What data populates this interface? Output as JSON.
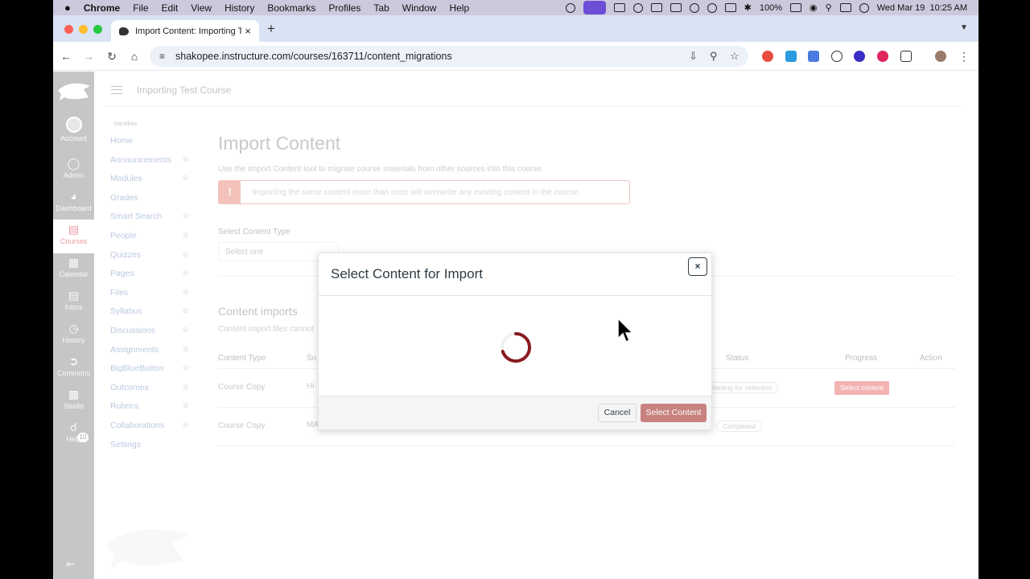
{
  "menubar": {
    "app": "Chrome",
    "items": [
      "File",
      "Edit",
      "View",
      "History",
      "Bookmarks",
      "Profiles",
      "Tab",
      "Window",
      "Help"
    ],
    "battery": "100%",
    "datetime": "Wed Mar 19  10:25 AM"
  },
  "browser": {
    "tab_title": "Import Content: Importing Te",
    "tab_close": "×",
    "new_tab": "+",
    "url": "shakopee.instructure.com/courses/163711/content_migrations"
  },
  "global_nav": {
    "items": [
      {
        "label": "Account",
        "icon": "avatar"
      },
      {
        "label": "Admin",
        "icon": "shield-icon"
      },
      {
        "label": "Dashboard",
        "icon": "dashboard-icon"
      },
      {
        "label": "Courses",
        "icon": "book-icon"
      },
      {
        "label": "Calendar",
        "icon": "calendar-icon"
      },
      {
        "label": "Inbox",
        "icon": "inbox-icon"
      },
      {
        "label": "History",
        "icon": "clock-icon"
      },
      {
        "label": "Commons",
        "icon": "commons-icon"
      },
      {
        "label": "Studio",
        "icon": "studio-icon"
      },
      {
        "label": "Help",
        "icon": "help-icon"
      }
    ],
    "help_badge": "10",
    "active_color": "#ea9aa3"
  },
  "header": {
    "breadcrumb": "Importing Test Course"
  },
  "course_nav": {
    "term": "Sandbox",
    "items": [
      "Home",
      "Announcements",
      "Modules",
      "Grades",
      "Smart Search",
      "People",
      "Quizzes",
      "Pages",
      "Files",
      "Syllabus",
      "Discussions",
      "Assignments",
      "BigBlueButton",
      "Outcomes",
      "Rubrics",
      "Collaborations",
      "Settings"
    ]
  },
  "main": {
    "title": "Import Content",
    "description": "Use the Import Content tool to migrate course materials from other sources into this course.",
    "warning_icon": "!",
    "warning": "Importing the same content more than once will overwrite any existing content in the course.",
    "select_type_label": "Select Content Type",
    "select_type_value": "Select one",
    "imports_heading": "Content imports",
    "imports_desc": "Content import files cannot",
    "table": {
      "headers": [
        "Content Type",
        "So",
        "Status",
        "Progress",
        "Action"
      ],
      "rows": [
        {
          "type": "Course Copy",
          "source": "Hi",
          "status": "Waiting for selection",
          "progress": "Select content"
        },
        {
          "type": "Course Copy",
          "source": "MA",
          "status": "Completed",
          "progress": ""
        }
      ]
    }
  },
  "modal": {
    "title": "Select Content for Import",
    "close": "×",
    "cancel": "Cancel",
    "select": "Select Content",
    "accent": "#8b1a22"
  }
}
